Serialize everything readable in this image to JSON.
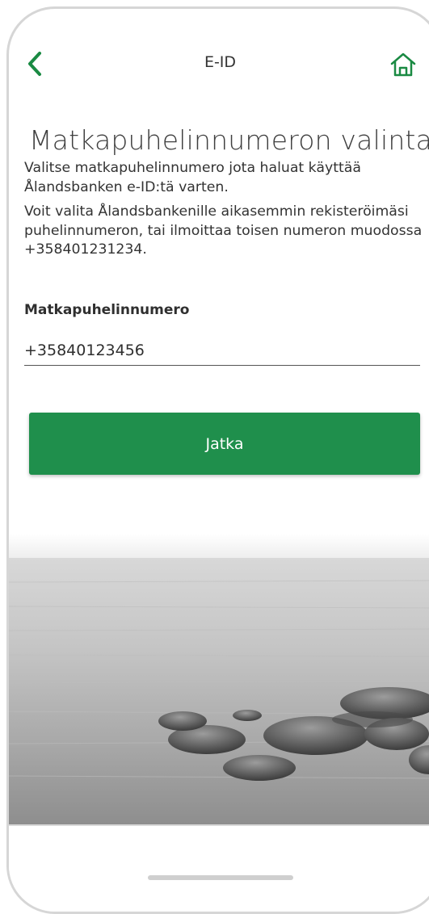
{
  "header": {
    "title": "E-ID",
    "back_icon": "chevron-left-icon",
    "home_icon": "home-icon"
  },
  "main": {
    "title": "Matkapuhelinnumeron valinta",
    "paragraphs": [
      "Valitse matkapuhelinnumero jota haluat käyttää Ålandsbanken e-ID:tä varten.",
      "Voit valita Ålandsbankenille aikasemmin rekisteröimäsi puhelinnumeron, tai ilmoittaa toisen numeron muodossa +358401231234."
    ],
    "field_label": "Matkapuhelinnumero",
    "field_value": "+35840123456",
    "continue_label": "Jatka"
  },
  "colors": {
    "accent": "#1f8f4c",
    "icon_green": "#1a8a43"
  }
}
